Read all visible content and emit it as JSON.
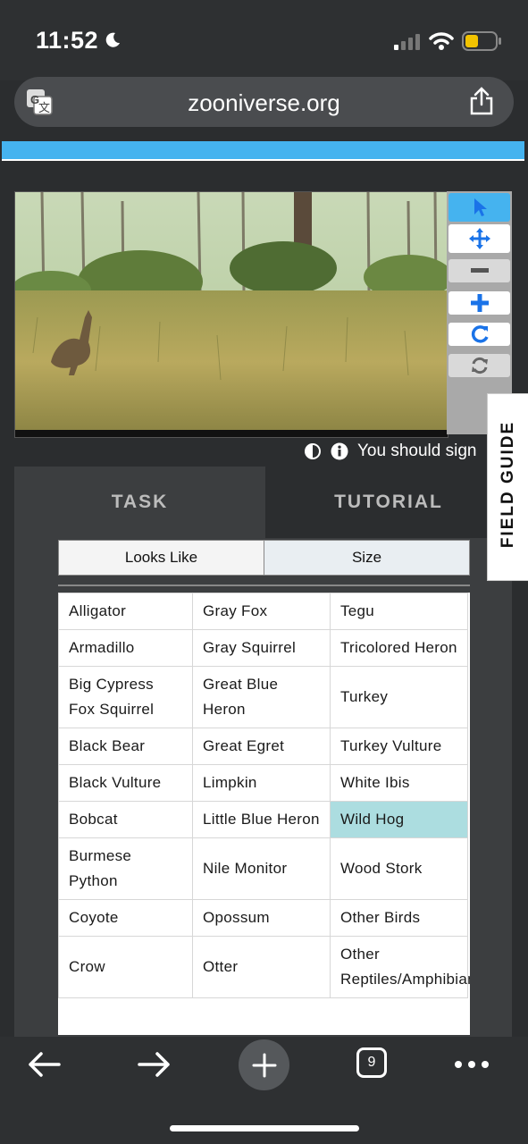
{
  "status": {
    "time": "11:52"
  },
  "browser": {
    "url": "zooniverse.org",
    "tab_count": "9"
  },
  "info": {
    "text": "You should sign"
  },
  "field_guide": {
    "label": "FIELD GUIDE"
  },
  "tabs": {
    "task": "TASK",
    "tutorial": "TUTORIAL"
  },
  "filters": {
    "looks_like": "Looks Like",
    "size": "Size"
  },
  "species": [
    [
      "Alligator",
      "Gray Fox",
      "Tegu"
    ],
    [
      "Armadillo",
      "Gray Squirrel",
      "Tricolored Heron"
    ],
    [
      "Big Cypress Fox Squirrel",
      "Great Blue Heron",
      "Turkey"
    ],
    [
      "Black Bear",
      "Great Egret",
      "Turkey Vulture"
    ],
    [
      "Black Vulture",
      "Limpkin",
      "White Ibis"
    ],
    [
      "Bobcat",
      "Little Blue Heron",
      "Wild Hog"
    ],
    [
      "Burmese Python",
      "Nile Monitor",
      "Wood Stork"
    ],
    [
      "Coyote",
      "Opossum",
      "Other Birds"
    ],
    [
      "Crow",
      "Otter",
      "Other Reptiles/Amphibians"
    ]
  ],
  "selected_species": "Wild Hog",
  "colors": {
    "accent_blue": "#45b3ef",
    "selected": "#acdde0",
    "tool_icon": "#1a73e8"
  }
}
